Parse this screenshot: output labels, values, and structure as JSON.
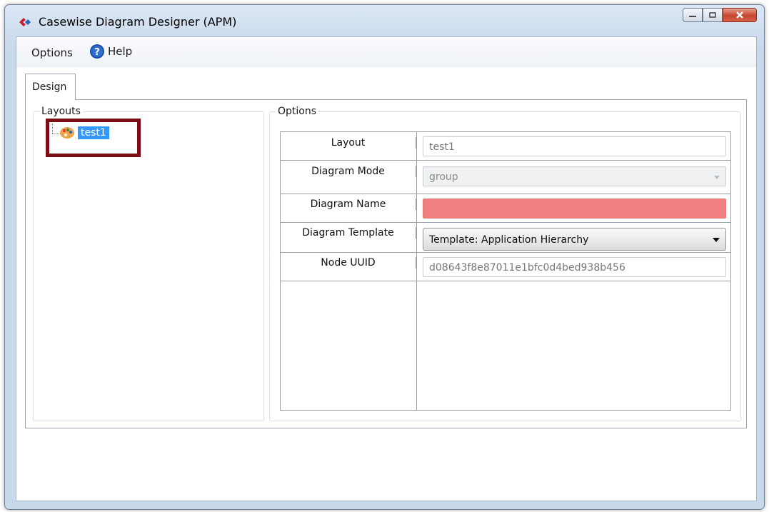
{
  "window": {
    "title": "Casewise Diagram Designer (APM)",
    "icon": "app-diamond-icon"
  },
  "menu": {
    "options_label": "Options",
    "help_label": "Help"
  },
  "tabs": [
    {
      "label": "Design"
    }
  ],
  "layouts": {
    "group_title": "Layouts",
    "items": [
      {
        "label": "test1",
        "icon": "palette-icon",
        "selected": true
      }
    ]
  },
  "options": {
    "group_title": "Options",
    "rows": [
      {
        "label": "Layout",
        "value": "test1",
        "kind": "text"
      },
      {
        "label": "Diagram Mode",
        "value": "group",
        "kind": "select-disabled"
      },
      {
        "label": "Diagram Name",
        "value": "",
        "kind": "text-invalid"
      },
      {
        "label": "Diagram Template",
        "value": "Template: Application Hierarchy",
        "kind": "select"
      },
      {
        "label": "Node UUID",
        "value": "d08643f8e87011e1bfc0d4bed938b456",
        "kind": "text"
      }
    ]
  },
  "colors": {
    "selection": "#3399ff",
    "invalid_field": "#f08080",
    "highlight_box": "#7a0e14"
  }
}
